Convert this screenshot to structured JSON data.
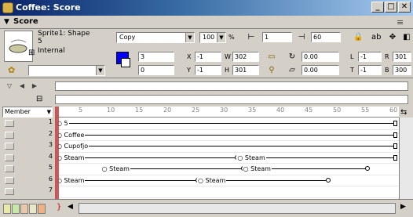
{
  "window": {
    "title": "Coffee: Score"
  },
  "header": {
    "label": "Score"
  },
  "sprite": {
    "name_line1": "Sprite1: Shape",
    "name_line2": "5",
    "name_line3": "Internal",
    "ink": "Copy",
    "blend": "100",
    "blend_unit": "%",
    "start_frame": "1",
    "end_frame": "60",
    "fore_value": "3",
    "back_value": "0",
    "x_label": "X",
    "x_value": "-1",
    "y_label": "Y",
    "y_value": "-1",
    "w_label": "W",
    "w_value": "302",
    "h_label": "H",
    "h_value": "301",
    "rotation": "0.00",
    "skew": "0.00",
    "l_label": "L",
    "l_value": "-1",
    "r_label": "R",
    "r_value": "301",
    "t_label": "T",
    "t_value": "-1",
    "b_label": "B",
    "b_value": "300",
    "colors": {
      "fore": "#0000ff",
      "back": "#ffffff"
    }
  },
  "score": {
    "member_label": "Member",
    "ruler_ticks": [
      "5",
      "10",
      "15",
      "20",
      "25",
      "30",
      "35",
      "40",
      "45",
      "50",
      "55",
      "60"
    ],
    "channels": [
      "1",
      "2",
      "3",
      "4",
      "5",
      "6",
      "7"
    ],
    "sprites": [
      {
        "channel": 1,
        "label": "5",
        "start": 0,
        "end": 60
      },
      {
        "channel": 2,
        "label": "Coffee",
        "start": 0,
        "end": 60
      },
      {
        "channel": 3,
        "label": "Cupofjo",
        "start": 0,
        "end": 60
      },
      {
        "channel": 4,
        "label": "Steam",
        "start": 0,
        "end": 32
      },
      {
        "channel": 4,
        "label": "Steam",
        "start": 32,
        "end": 60
      },
      {
        "channel": 5,
        "label": "Steam",
        "start": 8,
        "end": 33
      },
      {
        "channel": 5,
        "label": "Steam",
        "start": 33,
        "end": 55
      },
      {
        "channel": 6,
        "label": "Steam",
        "start": 0,
        "end": 25
      },
      {
        "channel": 6,
        "label": "Steam",
        "start": 25,
        "end": 48
      }
    ]
  }
}
